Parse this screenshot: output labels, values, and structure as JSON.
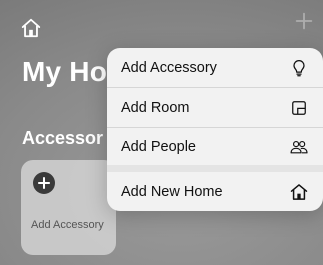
{
  "header": {
    "home_icon": "house-icon",
    "add_icon": "plus-icon"
  },
  "page": {
    "title": "My Ho"
  },
  "section": {
    "title": "Accessor"
  },
  "tile": {
    "icon": "plus-circle-icon",
    "label": "Add Accessory"
  },
  "menu": {
    "items": [
      {
        "label": "Add Accessory",
        "icon": "lightbulb-icon"
      },
      {
        "label": "Add Room",
        "icon": "room-icon"
      },
      {
        "label": "Add People",
        "icon": "people-icon"
      },
      {
        "label": "Add New Home",
        "icon": "house-icon"
      }
    ]
  },
  "colors": {
    "background": "#8a8a8a",
    "menu_bg": "#f2f2f2",
    "text_dark": "#111111",
    "text_light": "#ffffff"
  }
}
